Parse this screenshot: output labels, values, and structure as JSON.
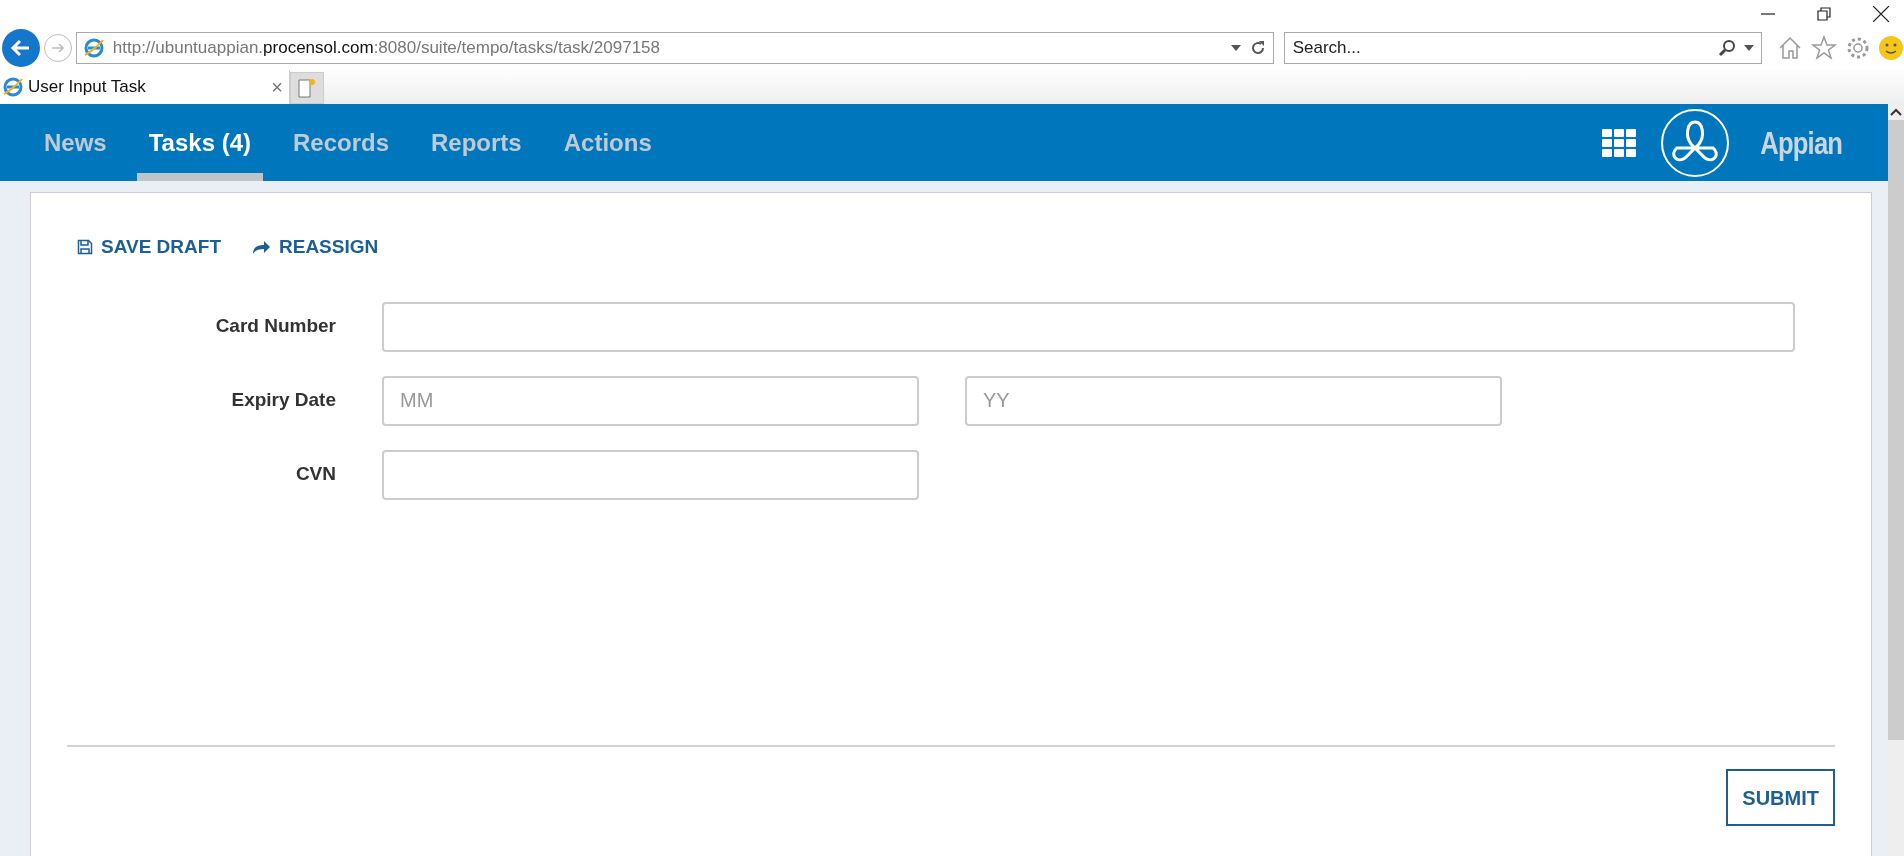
{
  "browser": {
    "url": {
      "prefix": "http://ubuntuappian.",
      "domain": "procensol.com",
      "suffix": ":8080/suite/tempo/tasks/task/2097158"
    },
    "search": {
      "placeholder": "Search..."
    },
    "tabs": [
      {
        "title": "User Input Task",
        "close": "×",
        "selected": true
      }
    ]
  },
  "nav": {
    "items": [
      {
        "label": "News",
        "selected": false
      },
      {
        "label": "Tasks (4)",
        "selected": true
      },
      {
        "label": "Records",
        "selected": false
      },
      {
        "label": "Reports",
        "selected": false
      },
      {
        "label": "Actions",
        "selected": false
      }
    ],
    "brand": "Appian"
  },
  "actions": [
    {
      "kind": "save",
      "label": "SAVE DRAFT"
    },
    {
      "kind": "reassign",
      "label": "REASSIGN"
    }
  ],
  "form": {
    "rows": [
      {
        "label": "Card Number",
        "fields": [
          {
            "kind": "wide"
          }
        ]
      },
      {
        "label": "Expiry Date",
        "fields": [
          {
            "placeholder": "MM",
            "kind": "narrow"
          },
          {
            "placeholder": "YY",
            "kind": "narrow"
          }
        ]
      },
      {
        "label": "CVN",
        "fields": [
          {
            "kind": "narrow"
          }
        ]
      }
    ]
  },
  "buttons": [
    {
      "label": "SUBMIT"
    }
  ]
}
